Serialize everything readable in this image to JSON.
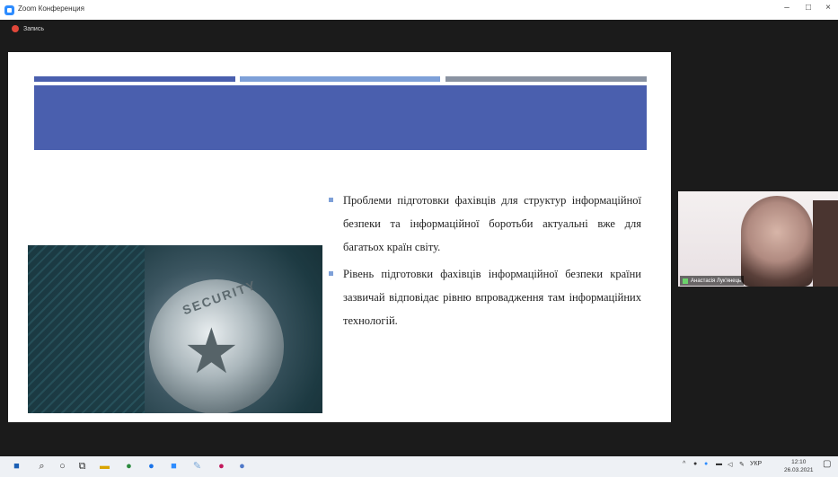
{
  "window": {
    "title": "Zoom Конференция",
    "controls": {
      "minimize": "–",
      "maximize": "□",
      "close": "×"
    }
  },
  "recording": {
    "label": "Запись"
  },
  "slide": {
    "bullets": [
      "Проблеми підготовки фахівців для структур інформаційної безпеки та інформаційної боротьби актуальні вже для багатьох країн світу.",
      "Рівень підготовки фахівців інформаційної безпеки країни зазвичай відповідає рівню впровадження там інформаційних технологій."
    ],
    "image": {
      "badge_text": "SECURITY"
    },
    "colors": {
      "banner": "#4a5fae",
      "bar_mid": "#7ea0d8",
      "bar_right": "#8a93a2"
    }
  },
  "participant": {
    "name": "Анастасія Лук'янець"
  },
  "taskbar": {
    "icons": [
      "windows-start-icon",
      "search-icon",
      "task-view-icon",
      "widgets-icon",
      "file-explorer-icon",
      "chrome-icon",
      "chrome-icon",
      "zoom-icon",
      "paint-icon",
      "app-icon",
      "app-icon"
    ],
    "tray": {
      "language": "УКР",
      "time": "12:10",
      "date": "26.03.2021"
    }
  }
}
